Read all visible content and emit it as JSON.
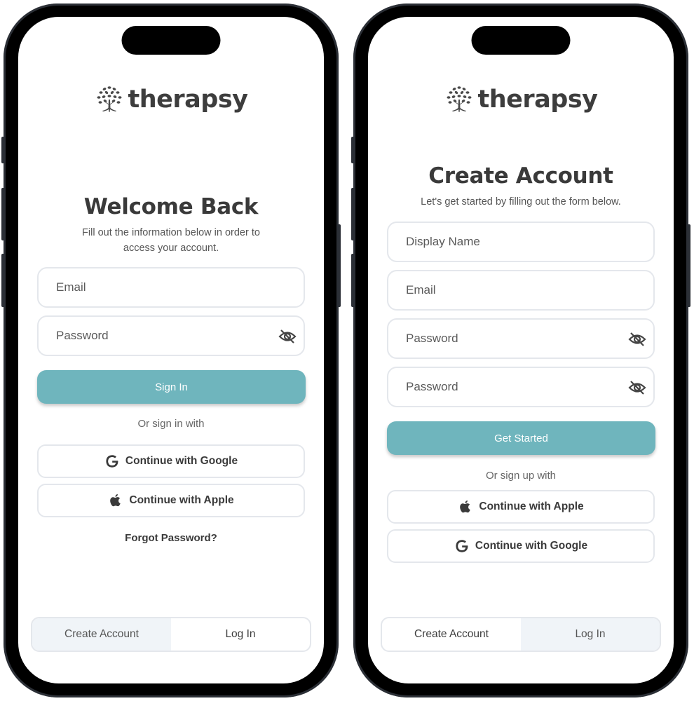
{
  "brand": {
    "name": "therapsy",
    "logo_icon": "tree-icon"
  },
  "colors": {
    "primary": "#6fb5bd",
    "frame": "#000000",
    "field_border": "#e4e7ec",
    "tab_inactive_bg": "#f0f4f8"
  },
  "login_screen": {
    "title": "Welcome Back",
    "subtitle_line1": "Fill out the information below in order to",
    "subtitle_line2": "access your account.",
    "fields": [
      {
        "placeholder": "Email",
        "icon": null
      },
      {
        "placeholder": "Password",
        "icon": "eye-off-icon"
      }
    ],
    "primary_button": "Sign In",
    "divider": "Or sign in with",
    "social_buttons": [
      {
        "label": "Continue with Google",
        "icon": "google-icon"
      },
      {
        "label": "Continue with Apple",
        "icon": "apple-icon"
      }
    ],
    "forgot_password": "Forgot Password?",
    "tabs": [
      {
        "label": "Create Account",
        "active": false
      },
      {
        "label": "Log In",
        "active": true
      }
    ]
  },
  "signup_screen": {
    "title": "Create Account",
    "subtitle": "Let's get started by filling out the form below.",
    "fields": [
      {
        "placeholder": "Display Name",
        "icon": null
      },
      {
        "placeholder": "Email",
        "icon": null
      },
      {
        "placeholder": "Password",
        "icon": "eye-off-icon"
      },
      {
        "placeholder": "Password",
        "icon": "eye-off-icon"
      }
    ],
    "primary_button": "Get Started",
    "divider": "Or sign up with",
    "social_buttons": [
      {
        "label": "Continue with Apple",
        "icon": "apple-icon"
      },
      {
        "label": "Continue with Google",
        "icon": "google-icon"
      }
    ],
    "tabs": [
      {
        "label": "Create Account",
        "active": true
      },
      {
        "label": "Log In",
        "active": false
      }
    ]
  }
}
